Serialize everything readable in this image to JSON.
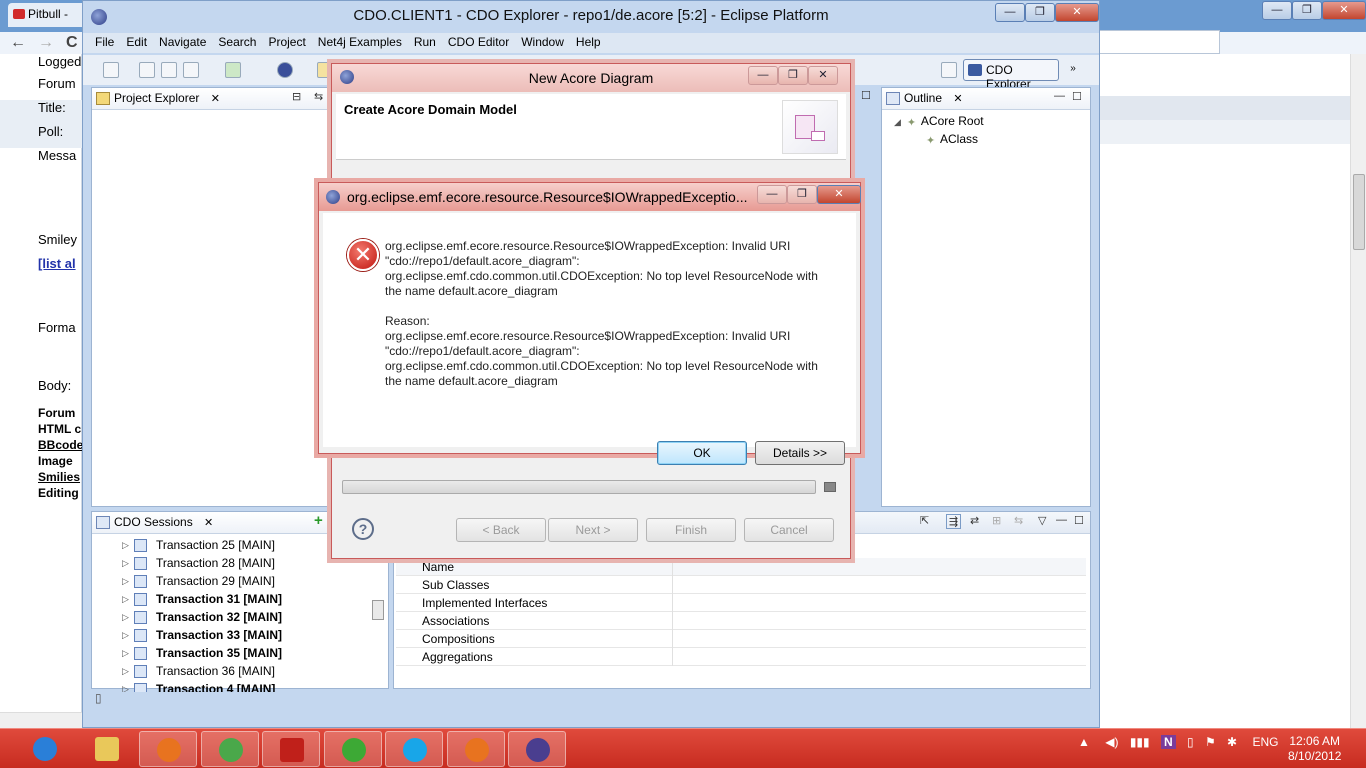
{
  "browser": {
    "tab_title": "Pitbull -",
    "back_glyph": "←",
    "forward_glyph": "→",
    "reload_glyph": "C",
    "controls": {
      "minimize": "—",
      "maximize": "❐",
      "close": "✕"
    },
    "page_left_rows": [
      "Logged",
      "Forum",
      "Title:",
      "Poll:",
      "Messa",
      "Smiley",
      "[list al",
      "Forma",
      "Body:",
      "Forum",
      "HTML c",
      "BBcode",
      "Image",
      "Smilies",
      "Editing"
    ]
  },
  "eclipse": {
    "title": "CDO.CLIENT1 - CDO Explorer - repo1/de.acore [5:2] - Eclipse Platform",
    "controls": {
      "minimize": "—",
      "maximize": "❐",
      "close": "✕"
    },
    "menu": [
      "File",
      "Edit",
      "Navigate",
      "Search",
      "Project",
      "Net4j Examples",
      "Run",
      "CDO Editor",
      "Window",
      "Help"
    ],
    "perspective_label": "CDO Explorer",
    "perspective_more": "»",
    "project_explorer_title": "Project Explorer",
    "outline_title": "Outline",
    "outline_items": [
      "ACore Root",
      "AClass"
    ],
    "cdo_sessions_title": "CDO Sessions",
    "view_close": "✕",
    "panel_min": "—",
    "panel_max": "☐",
    "add_glyph": "+",
    "transactions": [
      {
        "label": "Transaction 25 [MAIN]",
        "bold": false
      },
      {
        "label": "Transaction 28 [MAIN]",
        "bold": false
      },
      {
        "label": "Transaction 29 [MAIN]",
        "bold": false
      },
      {
        "label": "Transaction 31 [MAIN]",
        "bold": true
      },
      {
        "label": "Transaction 32 [MAIN]",
        "bold": true
      },
      {
        "label": "Transaction 33 [MAIN]",
        "bold": true
      },
      {
        "label": "Transaction 35 [MAIN]",
        "bold": true
      },
      {
        "label": "Transaction 36 [MAIN]",
        "bold": false
      },
      {
        "label": "Transaction 4 [MAIN]",
        "bold": true
      }
    ],
    "properties_rows": [
      "Name",
      "Sub Classes",
      "Implemented Interfaces",
      "Associations",
      "Compositions",
      "Aggregations"
    ]
  },
  "wizard": {
    "title": "New Acore Diagram",
    "heading": "Create Acore Domain Model",
    "buttons": {
      "back": "< Back",
      "next": "Next >",
      "finish": "Finish",
      "cancel": "Cancel"
    },
    "help_glyph": "?"
  },
  "error_dialog": {
    "title": "org.eclipse.emf.ecore.resource.Resource$IOWrappedExceptio...",
    "error_glyph": "✕",
    "message_lines": [
      "org.eclipse.emf.ecore.resource.Resource$IOWrappedException: Invalid URI",
      "\"cdo://repo1/default.acore_diagram\":",
      "org.eclipse.emf.cdo.common.util.CDOException: No top level ResourceNode with",
      "the name default.acore_diagram"
    ],
    "reason_label": "Reason:",
    "reason_lines": [
      "org.eclipse.emf.ecore.resource.Resource$IOWrappedException: Invalid URI",
      "\"cdo://repo1/default.acore_diagram\":",
      "org.eclipse.emf.cdo.common.util.CDOException: No top level ResourceNode with",
      "the name default.acore_diagram"
    ],
    "ok_label": "OK",
    "details_label": "Details >>"
  },
  "taskbar": {
    "apps": [
      "Internet Explorer",
      "Windows Explorer",
      "Firefox",
      "Chrome",
      "Adobe Reader",
      "uTorrent",
      "Skype",
      "Firefox",
      "Eclipse"
    ],
    "tray_language": "ENG",
    "clock_time": "12:06 AM",
    "clock_date": "8/10/2012"
  }
}
